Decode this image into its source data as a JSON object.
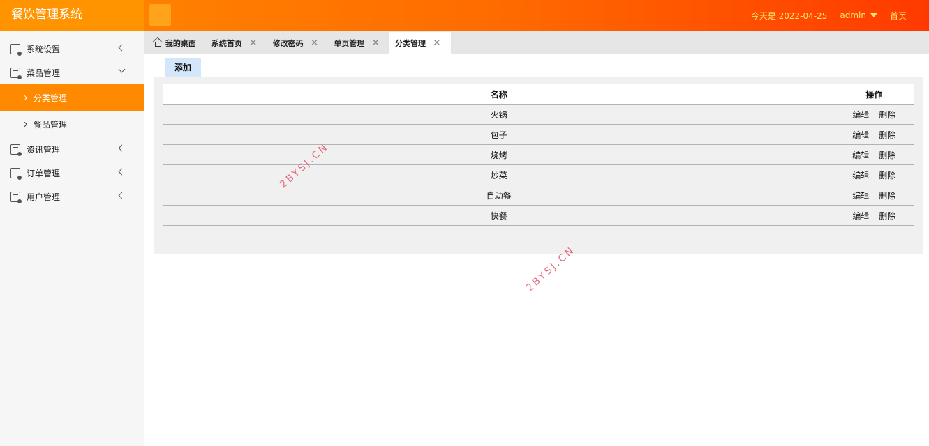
{
  "header": {
    "app_title": "餐饮管理系统",
    "date_text": "今天是 2022-04-25",
    "username": "admin",
    "home_link": "首页"
  },
  "sidebar": {
    "items": [
      {
        "label": "系统设置"
      },
      {
        "label": "菜品管理"
      },
      {
        "label": "分类管理"
      },
      {
        "label": "餐品管理"
      },
      {
        "label": "资讯管理"
      },
      {
        "label": "订单管理"
      },
      {
        "label": "用户管理"
      }
    ]
  },
  "tabs": [
    {
      "label": "我的桌面"
    },
    {
      "label": "系统首页"
    },
    {
      "label": "修改密码"
    },
    {
      "label": "单页管理"
    },
    {
      "label": "分类管理"
    }
  ],
  "toolbar": {
    "add_label": "添加"
  },
  "table": {
    "headers": {
      "name": "名称",
      "actions": "操作"
    },
    "rows": [
      {
        "name": "火锅"
      },
      {
        "name": "包子"
      },
      {
        "name": "烧烤"
      },
      {
        "name": "炒菜"
      },
      {
        "name": "自助餐"
      },
      {
        "name": "快餐"
      }
    ],
    "edit_label": "编辑",
    "delete_label": "删除"
  },
  "watermark": "2BYSJ.CN",
  "colors": {
    "header_start": "#ff8a00",
    "header_end": "#ff3a00",
    "active_menu": "#ff8a00",
    "add_button": "#d4e7fa"
  }
}
